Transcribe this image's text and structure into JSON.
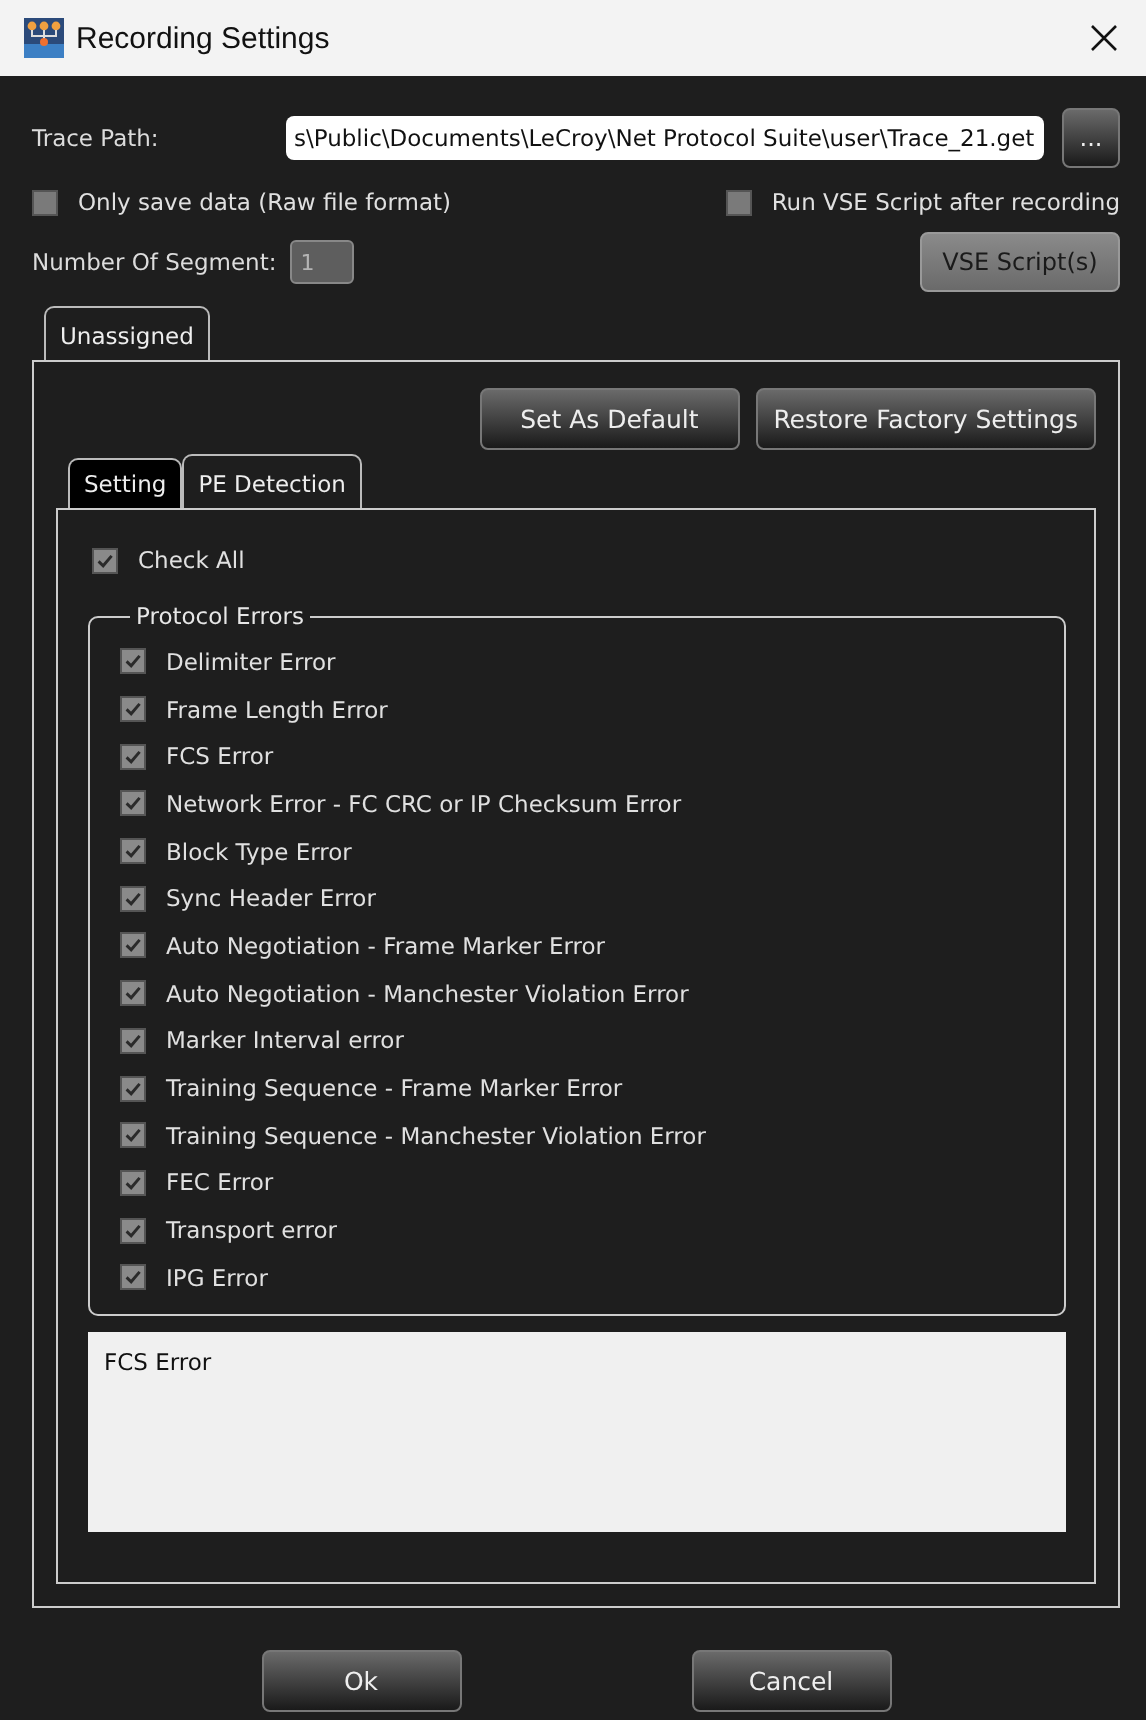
{
  "window": {
    "title": "Recording Settings"
  },
  "trace_path": {
    "label": "Trace Path:",
    "value": "s\\Public\\Documents\\LeCroy\\Net Protocol Suite\\user\\Trace_21.get",
    "browse_button": "..."
  },
  "options": [
    {
      "label": "Only save data (Raw file format)",
      "checked": false
    },
    {
      "label": "Run VSE Script after recording",
      "checked": false
    }
  ],
  "segments": {
    "label": "Number Of Segment:",
    "value": "1",
    "disabled": true
  },
  "vse_button": {
    "label": "VSE Script(s)",
    "disabled": true
  },
  "outer_tabs": [
    {
      "label": "Unassigned",
      "selected": true
    }
  ],
  "actions": [
    "Set As Default",
    "Restore Factory Settings"
  ],
  "inner_tabs": [
    {
      "label": "Setting",
      "selected": false
    },
    {
      "label": "PE Detection",
      "selected": true
    }
  ],
  "check_all": {
    "label": "Check All",
    "checked": true
  },
  "group": {
    "title": "Protocol Errors",
    "items": [
      {
        "label": "Delimiter Error",
        "checked": true
      },
      {
        "label": "Frame Length Error",
        "checked": true
      },
      {
        "label": "FCS Error",
        "checked": true
      },
      {
        "label": "Network Error - FC CRC or IP Checksum Error",
        "checked": true
      },
      {
        "label": "Block Type Error",
        "checked": true
      },
      {
        "label": "Sync Header Error",
        "checked": true
      },
      {
        "label": "Auto Negotiation - Frame Marker Error",
        "checked": true
      },
      {
        "label": "Auto Negotiation - Manchester Violation Error",
        "checked": true
      },
      {
        "label": "Marker Interval error",
        "checked": true
      },
      {
        "label": "Training Sequence - Frame Marker Error",
        "checked": true
      },
      {
        "label": "Training Sequence - Manchester Violation Error",
        "checked": true
      },
      {
        "label": "FEC Error",
        "checked": true
      },
      {
        "label": "Transport error",
        "checked": true
      },
      {
        "label": "IPG Error",
        "checked": true
      }
    ]
  },
  "description": "FCS Error",
  "buttons": [
    "Ok",
    "Cancel"
  ]
}
